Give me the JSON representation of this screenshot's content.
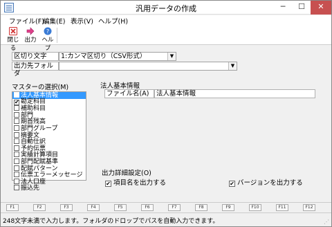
{
  "window": {
    "title": "汎用データの作成",
    "min_glyph": "─",
    "max_glyph": "☐",
    "close_glyph": "✕"
  },
  "menu": {
    "items": [
      "ファイル(F)",
      "編集(E)",
      "表示(V)",
      "ヘルプ(H)"
    ]
  },
  "toolbar": {
    "close_label": "閉じる",
    "output_label": "出力",
    "help_label": "ヘルプ",
    "icons": [
      "close-x-icon",
      "arrow-right-icon",
      "help-icon"
    ]
  },
  "settings": {
    "delimiter_label": "区切り文字",
    "delimiter_value": "1:カンマ区切り（CSV形式）",
    "folder_label": "出力先フォルダ",
    "folder_value": "",
    "dropdown_glyph": "▼"
  },
  "master": {
    "title": "マスターの選択(M)",
    "items": [
      {
        "label": "法人基本情報",
        "checked": false,
        "selected": true
      },
      {
        "label": "勘定科目",
        "checked": true,
        "selected": false
      },
      {
        "label": "補助科目",
        "checked": false,
        "selected": false
      },
      {
        "label": "部門",
        "checked": false,
        "selected": false
      },
      {
        "label": "期首残高",
        "checked": false,
        "selected": false
      },
      {
        "label": "部門グループ",
        "checked": false,
        "selected": false
      },
      {
        "label": "摘要文",
        "checked": false,
        "selected": false
      },
      {
        "label": "自動仕訳",
        "checked": false,
        "selected": false
      },
      {
        "label": "予約伝票",
        "checked": false,
        "selected": false
      },
      {
        "label": "実績計算項目",
        "checked": false,
        "selected": false
      },
      {
        "label": "部門配賦基準",
        "checked": false,
        "selected": false
      },
      {
        "label": "配賦パターン",
        "checked": false,
        "selected": false
      },
      {
        "label": "伝票エラーメッセージ",
        "checked": false,
        "selected": false
      },
      {
        "label": "法人口座",
        "checked": false,
        "selected": false
      },
      {
        "label": "振込先",
        "checked": false,
        "selected": false
      }
    ]
  },
  "detail": {
    "title": "法人基本情報",
    "filename_label": "ファイル名(A)",
    "filename_value": "法人基本情報"
  },
  "output": {
    "group_title": "出力詳細設定(O)",
    "item_name_label": "項目名を出力する",
    "item_name_checked": true,
    "version_label": "バージョンを出力する",
    "version_checked": true
  },
  "fkeys": [
    "F1",
    "F2",
    "F3",
    "F4",
    "F5",
    "F6",
    "F7",
    "F8",
    "F9",
    "F10",
    "F11",
    "F12"
  ],
  "status": {
    "text": "248文字未満で入力します。フォルダのドロップでパスを自動入力できます。",
    "grip_glyph": "⋰"
  },
  "colors": {
    "selection": "#3399ff",
    "close_button": "#c75050",
    "close_icon": "#d03030",
    "output_icon": "#e0408a",
    "help_icon": "#3a7bd5"
  }
}
